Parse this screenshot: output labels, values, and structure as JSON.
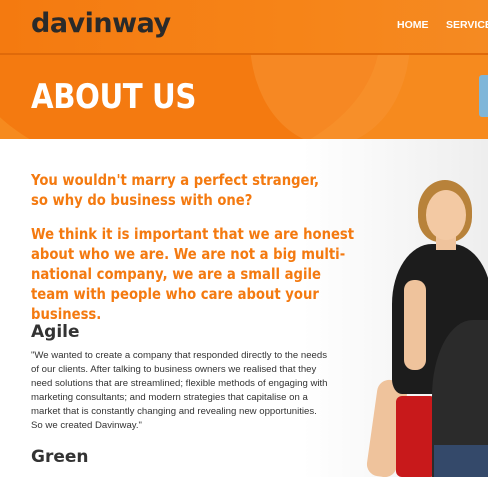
{
  "header": {
    "logo": "davinway",
    "nav": [
      "HOME",
      "SERVICES"
    ]
  },
  "banner": {
    "title": "ABOUT US"
  },
  "main": {
    "lead1": "You wouldn't marry a perfect stranger, so why do business with one?",
    "lead2": "We think it is important that we are honest about who we are. We are not a big multi- national company, we are a small agile team with people who care about your business.",
    "agile_heading": "Agile",
    "agile_text": "\"We wanted to create a company that responded directly to the needs of our clients. After talking to business owners we realised that they need solutions that are streamlined; flexible methods of engaging with marketing consultants; and modern strategies that capitalise on a market that is constantly changing and revealing new opportunities. So we created Davinway.\"",
    "green_heading": "Green"
  },
  "colors": {
    "brand_orange": "#f47a10",
    "text_dark": "#333333"
  }
}
